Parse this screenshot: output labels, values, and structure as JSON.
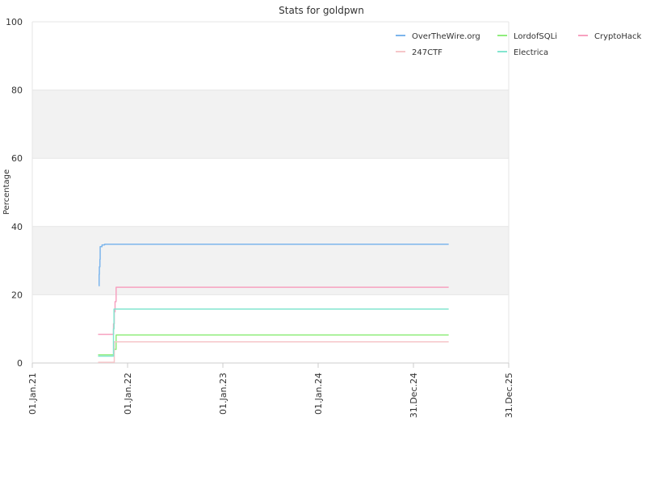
{
  "chart_data": {
    "type": "line",
    "title": "Stats for goldpwn",
    "ylabel": "Percentage",
    "xlabel": "",
    "ylim": [
      0,
      100
    ],
    "xlim": [
      "2021-01-01",
      "2025-12-31"
    ],
    "y_ticks": [
      0,
      20,
      40,
      60,
      80,
      100
    ],
    "x_ticks": [
      {
        "date": "2021-01-01",
        "label": "01.Jan.21"
      },
      {
        "date": "2022-01-01",
        "label": "01.Jan.22"
      },
      {
        "date": "2023-01-01",
        "label": "01.Jan.23"
      },
      {
        "date": "2024-01-01",
        "label": "01.Jan.24"
      },
      {
        "date": "2024-12-31",
        "label": "31.Dec.24"
      },
      {
        "date": "2025-12-31",
        "label": "31.Dec.25"
      }
    ],
    "bands": [
      [
        20,
        40
      ],
      [
        60,
        80
      ]
    ],
    "grid": true,
    "legend_position": "top-right",
    "series": [
      {
        "name": "OverTheWire.org",
        "color": "#7cb5ec",
        "points": [
          [
            "2021-09-13",
            22.6
          ],
          [
            "2021-09-14",
            26.0
          ],
          [
            "2021-09-15",
            28.2
          ],
          [
            "2021-09-17",
            30.4
          ],
          [
            "2021-09-18",
            34.1
          ],
          [
            "2021-09-25",
            34.6
          ],
          [
            "2021-10-05",
            34.8
          ],
          [
            "2025-05-15",
            34.8
          ]
        ]
      },
      {
        "name": "LordofSQLi",
        "color": "#90ed7d",
        "points": [
          [
            "2021-09-10",
            2.4
          ],
          [
            "2021-11-08",
            2.4
          ],
          [
            "2021-11-10",
            4.0
          ],
          [
            "2021-11-18",
            8.2
          ],
          [
            "2025-05-15",
            8.2
          ]
        ]
      },
      {
        "name": "CryptoHack",
        "color": "#f7a1c0",
        "points": [
          [
            "2021-09-10",
            8.4
          ],
          [
            "2021-11-05",
            8.4
          ],
          [
            "2021-11-08",
            11.5
          ],
          [
            "2021-11-11",
            15.0
          ],
          [
            "2021-11-14",
            18.0
          ],
          [
            "2021-11-18",
            22.2
          ],
          [
            "2025-05-15",
            22.2
          ]
        ]
      },
      {
        "name": "247CTF",
        "color": "#f6c6c9",
        "points": [
          [
            "2021-09-10",
            0.2
          ],
          [
            "2021-11-10",
            0.2
          ],
          [
            "2021-11-11",
            6.2
          ],
          [
            "2025-05-15",
            6.2
          ]
        ]
      },
      {
        "name": "Electrica",
        "color": "#83e5cf",
        "points": [
          [
            "2021-09-10",
            2.0
          ],
          [
            "2021-11-06",
            2.0
          ],
          [
            "2021-11-08",
            10.0
          ],
          [
            "2021-11-10",
            15.8
          ],
          [
            "2025-05-15",
            15.8
          ]
        ]
      }
    ]
  }
}
